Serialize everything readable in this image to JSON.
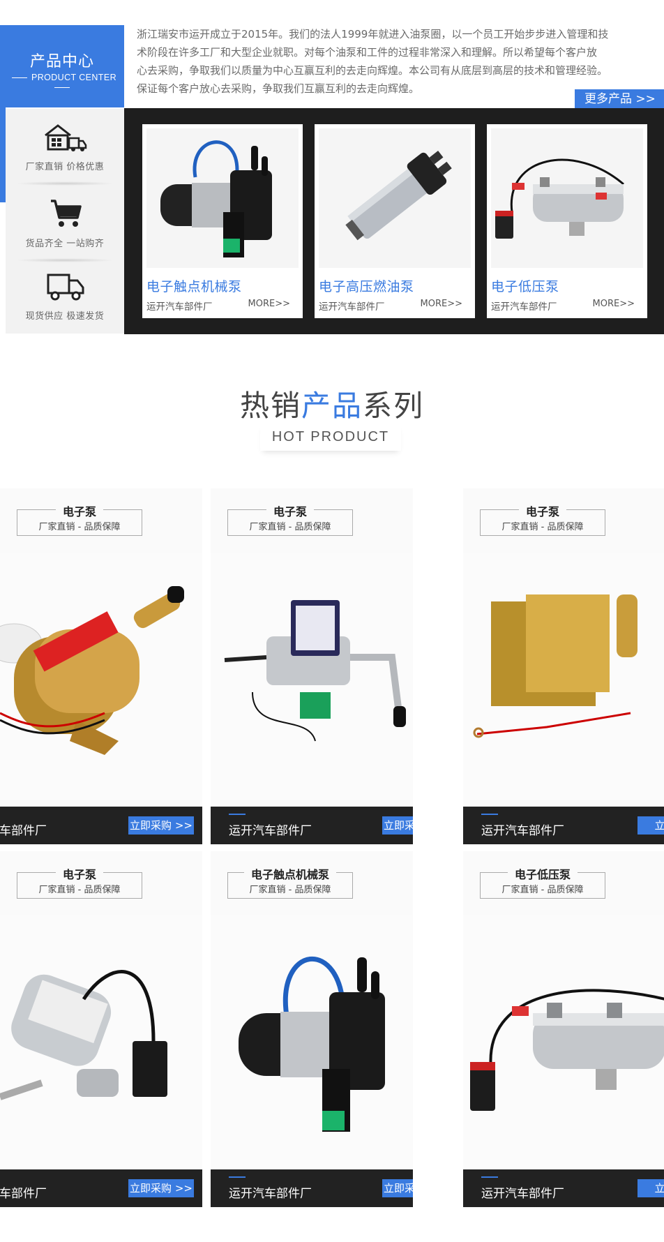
{
  "product_center": {
    "title_cn": "产品中心",
    "title_en": "PRODUCT CENTER"
  },
  "features": [
    {
      "label": "厂家直销  价格优惠",
      "icon": "warehouse-truck-icon"
    },
    {
      "label": "货品齐全  一站购齐",
      "icon": "shopping-cart-icon"
    },
    {
      "label": "现货供应  极速发货",
      "icon": "delivery-truck-icon"
    }
  ],
  "intro": {
    "text": "浙江瑞安市运开成立于2015年。我们的法人1999年就进入油泵圈，以一个员工开始步步进入管理和技\n术阶段在许多工厂和大型企业就职。对每个油泵和工件的过程非常深入和理解。所以希望每个客户放\n心去采购，争取我们以质量为中心互赢互利的去走向辉煌。本公司有从底层到高层的技术和管理经验。\n保证每个客户放心去采购，争取我们互赢互利的去走向辉煌。"
  },
  "more_button": "更多产品 >>",
  "featured_products": [
    {
      "title": "电子触点机械泵",
      "maker": "运开汽车部件厂",
      "more": "MORE>>"
    },
    {
      "title": "电子高压燃油泵",
      "maker": "运开汽车部件厂",
      "more": "MORE>>"
    },
    {
      "title": "电子低压泵",
      "maker": "运开汽车部件厂",
      "more": "MORE>>"
    }
  ],
  "hot": {
    "title_part1": "热销",
    "title_accent": "产品",
    "title_part3": "系列",
    "subtitle": "HOT PRODUCT"
  },
  "hot_products": [
    {
      "name": "电子泵",
      "tag": "厂家直销 - 品质保障",
      "maker": "汽车部件厂",
      "buy": "立即采购 >>"
    },
    {
      "name": "电子泵",
      "tag": "厂家直销 - 品质保障",
      "maker": "运开汽车部件厂",
      "buy": "立即采购 >>"
    },
    {
      "name": "电子泵",
      "tag": "厂家直销 - 品质保障",
      "maker": "运开汽车部件厂",
      "buy": "立即采"
    },
    {
      "name": "电子泵",
      "tag": "厂家直销 - 品质保障",
      "maker": "汽车部件厂",
      "buy": "立即采购 >>"
    },
    {
      "name": "电子触点机械泵",
      "tag": "厂家直销 - 品质保障",
      "maker": "运开汽车部件厂",
      "buy": "立即采购 >>"
    },
    {
      "name": "电子低压泵",
      "tag": "厂家直销 - 品质保障",
      "maker": "运开汽车部件厂",
      "buy": "立即采"
    }
  ],
  "colors": {
    "accent": "#3a7be0",
    "dark": "#1e1e1e"
  }
}
